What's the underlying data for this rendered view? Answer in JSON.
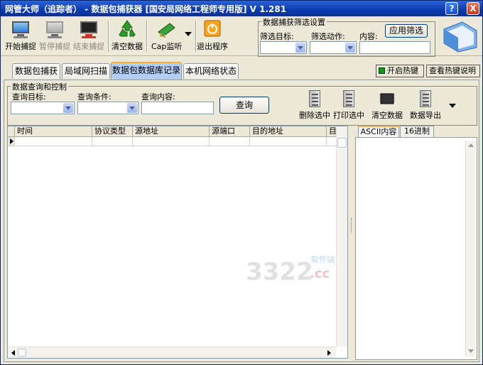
{
  "window": {
    "title": "网管大师（追踪者） - 数据包捕获器 [国安局网络工程师专用版] V 1.281",
    "help_label": "?",
    "close_label": "X"
  },
  "toolbar": {
    "start_capture": "开始捕捉",
    "pause_capture": "暂停捕捉",
    "stop_capture": "结束捕捉",
    "clear_data": "清空数据",
    "cap_listen": "Cap监听",
    "exit": "退出程序"
  },
  "capture_filter": {
    "title": "数据捕获筛选设置",
    "target_label": "筛选目标:",
    "action_label": "筛选动作:",
    "content_label": "内容:",
    "apply_button": "应用筛选",
    "target_value": "",
    "action_value": "",
    "content_value": ""
  },
  "tabs": [
    {
      "label": "数据包捕获"
    },
    {
      "label": "局域网扫描"
    },
    {
      "label": "数据包数据库记录"
    },
    {
      "label": "本机网络状态"
    }
  ],
  "hotkeys": {
    "enable": "开启热键",
    "help": "查看热键说明"
  },
  "query": {
    "title": "数据查询和控制",
    "target_label": "查询目标:",
    "condition_label": "查询条件:",
    "content_label": "查询内容:",
    "target_value": "",
    "condition_value": "",
    "content_value": "",
    "query_button": "查询",
    "delete_selected": "删除选中",
    "print_selected": "打印选中",
    "clear_data": "清空数据",
    "export_data": "数据导出"
  },
  "table": {
    "columns": [
      "时间",
      "协议类型",
      "源地址",
      "源端口",
      "目的地址",
      "目"
    ]
  },
  "detail_tabs": [
    {
      "label": "ASCII内容"
    },
    {
      "label": "16进制"
    }
  ],
  "watermark": {
    "number": "3322",
    "suffix": ".cc",
    "site": "软件站"
  }
}
